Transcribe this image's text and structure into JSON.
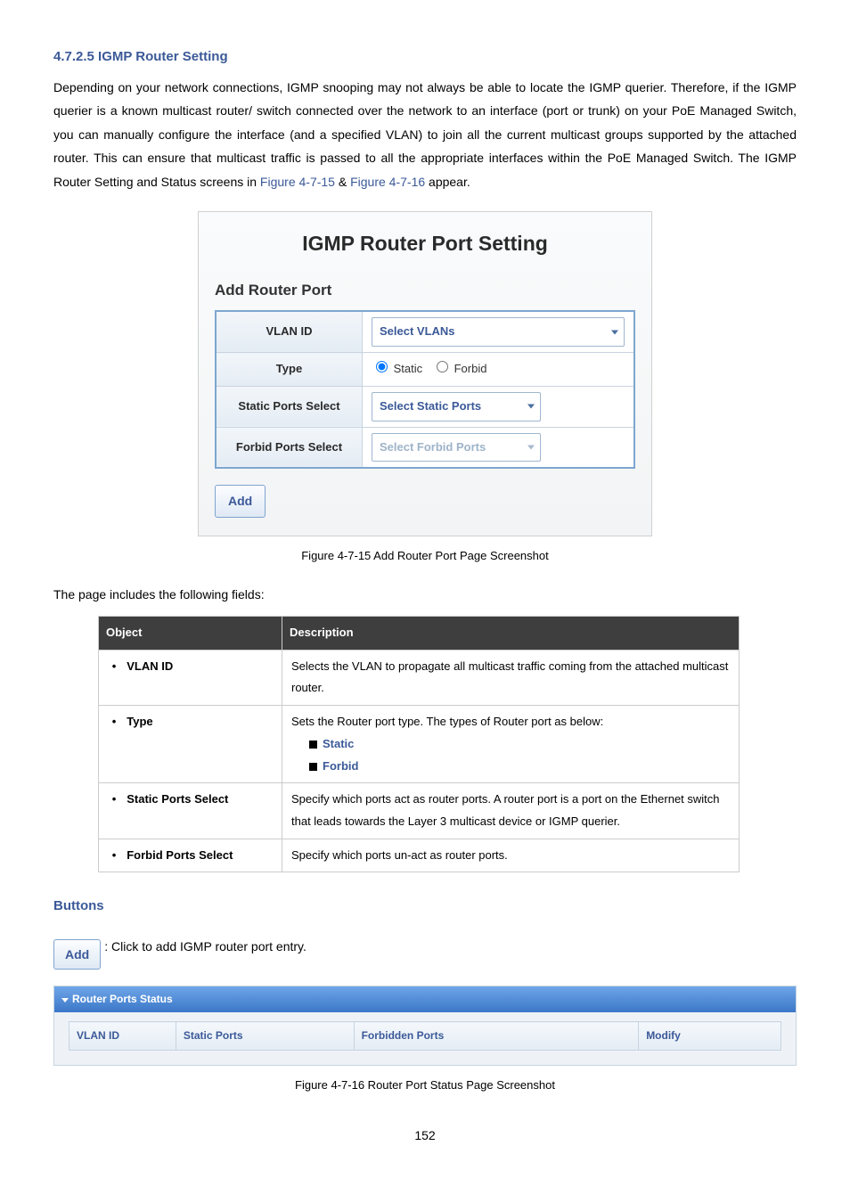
{
  "intro": {
    "text": "Depending on your network connections, IGMP snooping may not always be able to locate the IGMP querier. Therefore, if the IGMP querier is a known multicast router/ switch connected over the network to an interface (port or trunk) on your PoE Managed Switch, you can manually configure the interface (and a specified VLAN) to join all the current multicast groups supported by the attached router. This can ensure that multicast traffic is passed to all the appropriate interfaces within the PoE Managed Switch. The IGMP Router Setting and Status screens in ",
    "figref1": "Figure 4-7-15",
    "sep": " & ",
    "figref2": "Figure 4-7-16",
    "tail": " appear."
  },
  "panel1": {
    "title": "IGMP Router Port Setting",
    "sub": "Add Router Port",
    "rows": [
      {
        "label": "VLAN ID",
        "type": "select-wide",
        "placeholder": "Select VLANs"
      },
      {
        "label": "Type",
        "type": "radio",
        "opt1": "Static",
        "opt2": "Forbid"
      },
      {
        "label": "Static Ports Select",
        "type": "select",
        "placeholder": "Select Static Ports"
      },
      {
        "label": "Forbid Ports Select",
        "type": "select-dis",
        "placeholder": "Select Forbid Ports"
      }
    ],
    "add_btn": "Add"
  },
  "caption1_pre": "Figure 4-7-15",
  "caption1_post": " Add Router Port Page Screenshot",
  "fields_intro": "The page includes the following fields:",
  "fields_head_obj": "Object",
  "fields_head_desc": "Description",
  "fields": [
    {
      "name": "VLAN ID",
      "desc": "Selects the VLAN to propagate all multicast traffic coming from the attached multicast router."
    },
    {
      "name": "Type",
      "desc": "Sets the Router port type. The types of Router port as below:",
      "subs": [
        "Static",
        "Forbid"
      ]
    },
    {
      "name": "Static Ports Select",
      "desc": "Specify which ports act as router ports. A router port is a port on the Ethernet switch that leads towards the Layer 3 multicast device or IGMP querier."
    },
    {
      "name": "Forbid Ports Select",
      "desc": "Specify which ports un-act as router ports."
    }
  ],
  "buttons_heading": "Buttons",
  "add_btn2": "Add",
  "add_desc": ": Click to add IGMP router port entry.",
  "status": {
    "head": "Router Ports Status",
    "cols": [
      "VLAN ID",
      "Static Ports",
      "Forbidden Ports",
      "Modify"
    ]
  },
  "caption2_pre": "Figure 4-7-16",
  "caption2_post": " Router Port Status Page Screenshot",
  "section_title": "4.7.2.5 IGMP Router Setting",
  "page_num": "152"
}
